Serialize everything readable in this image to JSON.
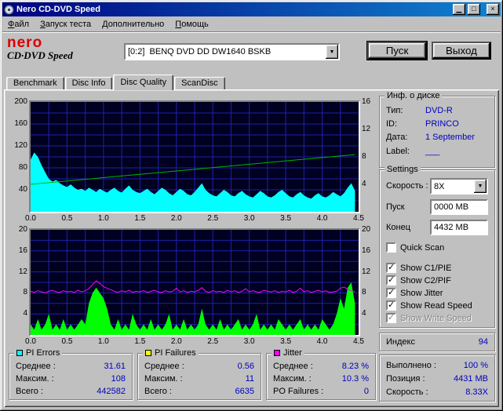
{
  "window": {
    "title": "Nero CD-DVD Speed"
  },
  "icons": {
    "minimize": "▁",
    "maximize": "□",
    "close": "×",
    "dropdown": "▼",
    "check": "✓"
  },
  "menu": {
    "items": [
      "Файл",
      "Запуск теста",
      "Дополнительно",
      "Помощь"
    ]
  },
  "header": {
    "logo": {
      "line1": "nero",
      "line2": "CD·DVD Speed"
    },
    "drive_selector": {
      "value": "[0:2]  BENQ DVD DD DW1640 BSKB"
    },
    "start_button": "Пуск",
    "exit_button": "Выход"
  },
  "tabs": {
    "labels": [
      "Benchmark",
      "Disc Info",
      "Disc Quality",
      "ScanDisc"
    ],
    "active": "Disc Quality"
  },
  "disc_info": {
    "title": "Инф. о диске",
    "rows": [
      {
        "label": "Тип:",
        "value": "DVD-R"
      },
      {
        "label": "ID:",
        "value": "PRINCO"
      },
      {
        "label": "Дата:",
        "value": "1 September"
      },
      {
        "label": "Label:",
        "value": "___"
      }
    ]
  },
  "settings": {
    "title": "Settings",
    "speed_label": "Скорость :",
    "speed_value": "8X",
    "start_label": "Пуск",
    "start_value": "0000 MB",
    "end_label": "Конец",
    "end_value": "4432 MB",
    "checkboxes": [
      {
        "label": "Quick Scan",
        "checked": false,
        "enabled": true
      },
      {
        "label": "Show C1/PIE",
        "checked": true,
        "enabled": true
      },
      {
        "label": "Show C2/PIF",
        "checked": true,
        "enabled": true
      },
      {
        "label": "Show Jitter",
        "checked": true,
        "enabled": true
      },
      {
        "label": "Show Read Speed",
        "checked": true,
        "enabled": true
      },
      {
        "label": "Show Write Speed",
        "checked": true,
        "enabled": false
      }
    ]
  },
  "index_panel": {
    "label": "Индекс",
    "value": "94"
  },
  "progress": {
    "rows": [
      {
        "label": "Выполнено :",
        "value": "100 %"
      },
      {
        "label": "Позиция :",
        "value": "4431 MB"
      },
      {
        "label": "Скорость :",
        "value": "8.33X"
      }
    ]
  },
  "stats": [
    {
      "title": "PI Errors",
      "color": "#00ffff",
      "rows": [
        {
          "label": "Среднее :",
          "value": "31.61"
        },
        {
          "label": "Максим. :",
          "value": "108"
        },
        {
          "label": "Всего :",
          "value": "442582"
        }
      ]
    },
    {
      "title": "PI Failures",
      "color": "#ffff00",
      "rows": [
        {
          "label": "Среднее :",
          "value": "0.56"
        },
        {
          "label": "Максим. :",
          "value": "11"
        },
        {
          "label": "Всего :",
          "value": "6635"
        }
      ]
    },
    {
      "title": "Jitter",
      "color": "#ff00ff",
      "rows": [
        {
          "label": "Среднее :",
          "value": "8.23 %"
        },
        {
          "label": "Максим. :",
          "value": "10.3 %"
        },
        {
          "label": "PO Failures :",
          "value": "0"
        }
      ]
    }
  ],
  "chart_data": [
    {
      "name": "PI Errors / Read Speed",
      "type": "area",
      "bg_color": "#000020",
      "grid_color": "#2121ad",
      "x_axis": {
        "range": [
          0,
          4.5
        ],
        "grid_step": 0.25,
        "labels": [
          "0.0",
          "0.5",
          "1.0",
          "1.5",
          "2.0",
          "2.5",
          "3.0",
          "3.5",
          "4.0",
          "4.5"
        ]
      },
      "left_axis": {
        "range": [
          0,
          200
        ],
        "grid_step": 20,
        "labels": [
          "40",
          "80",
          "120",
          "160",
          "200"
        ]
      },
      "right_axis": {
        "range": [
          0,
          16
        ],
        "labels": [
          "4",
          "8",
          "12",
          "16"
        ]
      },
      "series": [
        {
          "name": "PI Errors",
          "type": "area",
          "axis": "left",
          "color": "#00ffff",
          "x_start": 0,
          "x_step": 0.05,
          "values": [
            95,
            108,
            100,
            85,
            72,
            60,
            55,
            58,
            52,
            48,
            45,
            50,
            44,
            40,
            42,
            38,
            44,
            40,
            36,
            42,
            38,
            35,
            40,
            44,
            38,
            35,
            42,
            48,
            40,
            36,
            34,
            38,
            42,
            36,
            32,
            38,
            44,
            40,
            34,
            30,
            36,
            42,
            38,
            32,
            30,
            36,
            44,
            52,
            40,
            34,
            30,
            28,
            34,
            40,
            36,
            30,
            28,
            34,
            38,
            32,
            28,
            26,
            32,
            38,
            34,
            28,
            26,
            30,
            36,
            40,
            34,
            28,
            26,
            32,
            36,
            30,
            26,
            24,
            30,
            34,
            28,
            26,
            30,
            36,
            32,
            28,
            34,
            44,
            52,
            38
          ]
        },
        {
          "name": "Read Speed",
          "type": "line",
          "axis": "right",
          "color": "#00b400",
          "points": [
            [
              0,
              4.0
            ],
            [
              4.45,
              8.33
            ]
          ]
        }
      ]
    },
    {
      "name": "PI Failures / Jitter",
      "type": "area",
      "bg_color": "#000020",
      "grid_color": "#2121ad",
      "x_axis": {
        "range": [
          0,
          4.5
        ],
        "grid_step": 0.25,
        "labels": [
          "0.0",
          "0.5",
          "1.0",
          "1.5",
          "2.0",
          "2.5",
          "3.0",
          "3.5",
          "4.0",
          "4.5"
        ]
      },
      "left_axis": {
        "range": [
          0,
          20
        ],
        "grid_step": 2,
        "labels": [
          "4",
          "8",
          "12",
          "16",
          "20"
        ]
      },
      "right_axis": {
        "range": [
          0,
          20
        ],
        "labels": [
          "4",
          "8",
          "12",
          "16",
          "20"
        ]
      },
      "series": [
        {
          "name": "PI Failures",
          "type": "area",
          "axis": "left",
          "color": "#00ff00",
          "x_start": 0,
          "x_step": 0.05,
          "values": [
            2,
            1,
            3,
            1,
            2,
            4,
            1,
            2,
            1,
            3,
            1,
            2,
            1,
            2,
            3,
            2,
            6,
            8,
            9,
            8,
            7,
            5,
            2,
            1,
            3,
            1,
            2,
            1,
            4,
            2,
            1,
            2,
            1,
            3,
            1,
            2,
            1,
            2,
            4,
            1,
            2,
            1,
            3,
            1,
            2,
            1,
            2,
            5,
            2,
            1,
            2,
            1,
            3,
            1,
            2,
            1,
            2,
            3,
            1,
            2,
            1,
            2,
            4,
            1,
            2,
            1,
            2,
            1,
            3,
            2,
            1,
            2,
            1,
            2,
            3,
            1,
            2,
            1,
            2,
            1,
            3,
            2,
            1,
            2,
            4,
            7,
            5,
            9,
            10,
            6
          ]
        },
        {
          "name": "Jitter",
          "type": "line",
          "axis": "right",
          "color": "#ff00ff",
          "x_start": 0,
          "x_step": 0.05,
          "values": [
            8.3,
            8.1,
            8.4,
            8.2,
            8.0,
            8.3,
            8.5,
            8.2,
            8.1,
            8.4,
            8.2,
            8.3,
            8.1,
            8.5,
            8.2,
            8.4,
            8.8,
            9.6,
            10.3,
            9.8,
            9.2,
            8.9,
            8.6,
            8.3,
            8.1,
            8.4,
            8.2,
            8.5,
            8.1,
            8.3,
            8.2,
            8.4,
            8.1,
            8.3,
            8.5,
            8.2,
            8.1,
            8.4,
            8.2,
            8.3,
            8.9,
            8.2,
            8.4,
            8.1,
            8.3,
            8.2,
            8.5,
            9.0,
            8.3,
            8.1,
            8.4,
            8.2,
            8.3,
            8.1,
            8.5,
            8.2,
            8.4,
            8.1,
            8.3,
            8.8,
            8.2,
            8.4,
            8.2,
            8.1,
            8.5,
            8.3,
            8.2,
            8.4,
            8.1,
            8.3,
            8.2,
            8.5,
            8.1,
            8.3,
            8.9,
            8.2,
            8.4,
            8.1,
            8.3,
            8.5,
            8.2,
            8.4,
            8.1,
            8.2,
            8.3,
            8.9,
            9.1,
            8.7,
            8.4,
            8.2
          ]
        }
      ]
    }
  ]
}
